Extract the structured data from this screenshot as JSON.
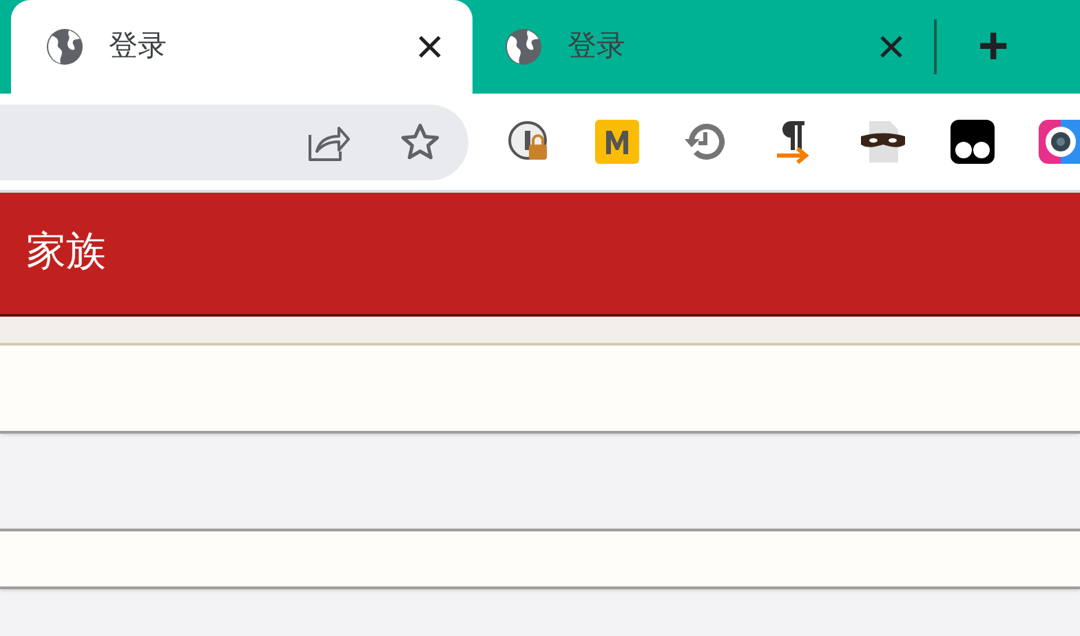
{
  "tabs": [
    {
      "title": "登录",
      "selected": true
    },
    {
      "title": "登录",
      "selected": false
    }
  ],
  "new_tab": "+",
  "header": {
    "title": "家族"
  }
}
